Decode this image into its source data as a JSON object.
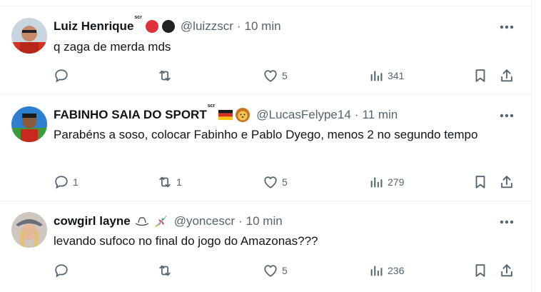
{
  "tweets": [
    {
      "name": "Luiz Henrique",
      "name_sup": "scr",
      "handle": "@luizzscr",
      "separator": "·",
      "time": "10 min",
      "text": "q zaga de merda mds",
      "replies": "",
      "retweets": "",
      "likes": "5",
      "views": "341"
    },
    {
      "name": "FABINHO SAIA DO SPORT",
      "name_sup": "scr",
      "handle": "@LucasFelype14",
      "separator": "·",
      "time": "11 min",
      "text": "Parabéns a soso, colocar Fabinho e Pablo Dyego, menos 2 no segundo tempo",
      "replies": "1",
      "retweets": "1",
      "likes": "5",
      "views": "279"
    },
    {
      "name": "cowgirl layne",
      "name_sup": "",
      "handle": "@yoncescr",
      "separator": "·",
      "time": "10 min",
      "text": "levando sufoco no final do jogo do Amazonas???",
      "replies": "",
      "retweets": "",
      "likes": "5",
      "views": "236"
    }
  ],
  "icons": {
    "more": "more-horizontal-icon",
    "reply": "reply-bubble-icon",
    "retweet": "retweet-icon",
    "like": "heart-icon",
    "views": "views-bar-chart-icon",
    "bookmark": "bookmark-icon",
    "share": "share-upload-icon"
  },
  "colors": {
    "text": "#0f1419",
    "secondary": "#536471",
    "divider": "#eff3f4",
    "red_dot": "#e0303c",
    "dark_dot": "#1f2125"
  }
}
